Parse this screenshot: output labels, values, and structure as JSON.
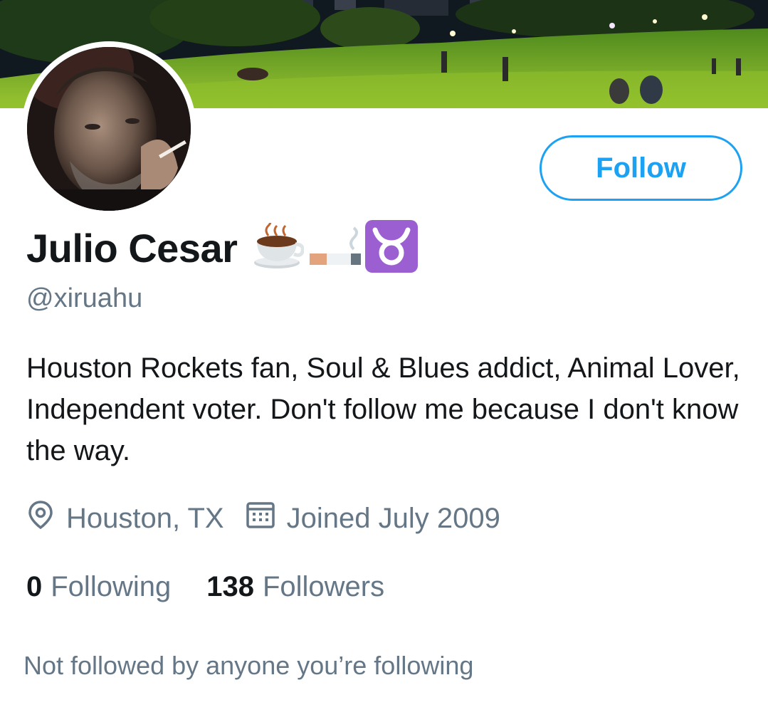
{
  "profile": {
    "display_name": "Julio Cesar",
    "name_emojis": [
      "hot-beverage",
      "cigarette",
      "taurus"
    ],
    "handle": "@xiruahu",
    "bio": "Houston Rockets fan, Soul & Blues addict, Animal Lover, Independent voter. Don't follow me because I don't know the way.",
    "location": "Houston, TX",
    "joined": "Joined July 2009",
    "following_count": "0",
    "following_label": "Following",
    "followers_count": "138",
    "followers_label": "Followers",
    "followed_by": "Not followed by anyone you’re following"
  },
  "actions": {
    "follow_label": "Follow"
  },
  "icons": {
    "location": "location-pin-icon",
    "joined": "calendar-icon"
  },
  "colors": {
    "accent": "#1da1f2",
    "primary_text": "#14171a",
    "secondary_text": "#657786",
    "taurus_bg": "#9b5fd1"
  }
}
